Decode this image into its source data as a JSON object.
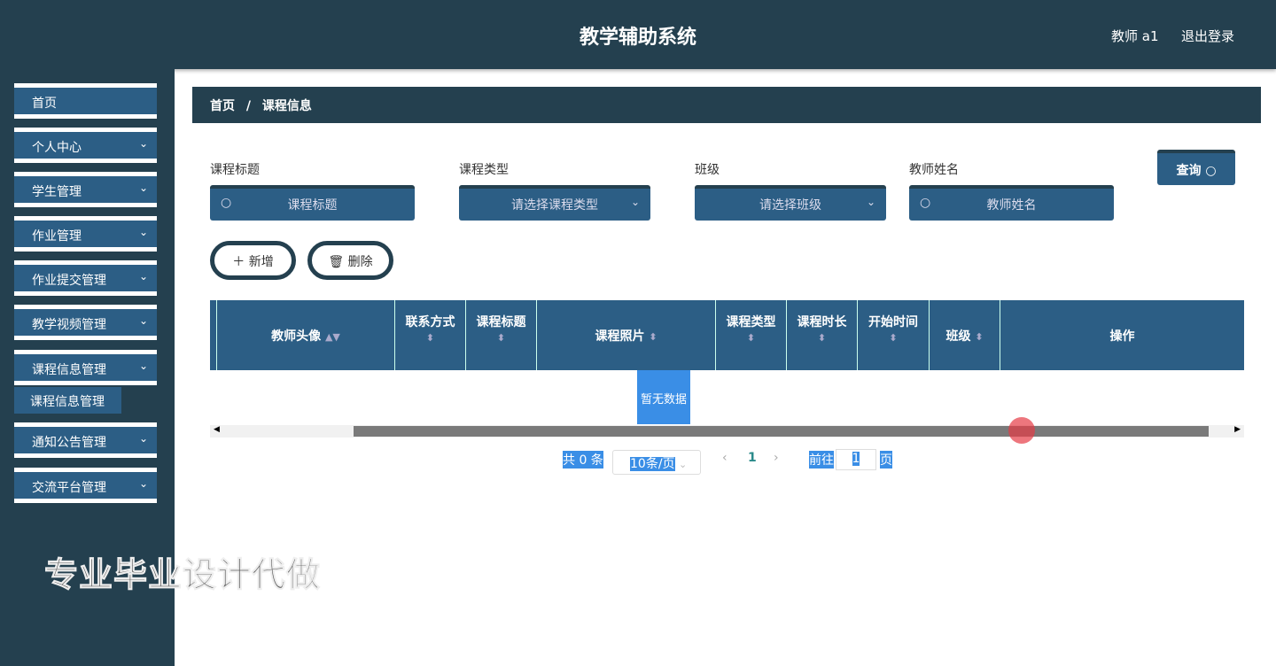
{
  "header": {
    "title": "教学辅助系统",
    "user": "教师 a1",
    "logout": "退出登录"
  },
  "sidebar": {
    "items": [
      {
        "label": "首页"
      },
      {
        "label": "个人中心"
      },
      {
        "label": "学生管理"
      },
      {
        "label": "作业管理"
      },
      {
        "label": "作业提交管理"
      },
      {
        "label": "教学视频管理"
      },
      {
        "label": "课程信息管理"
      },
      {
        "label": "通知公告管理"
      },
      {
        "label": "交流平台管理"
      }
    ],
    "sub_item": "课程信息管理"
  },
  "watermark": "专业毕业设计代做",
  "breadcrumb": {
    "home": "首页",
    "sep": "/",
    "current": "课程信息"
  },
  "search": {
    "fields": [
      {
        "label": "课程标题",
        "placeholder": "课程标题"
      },
      {
        "label": "课程类型",
        "placeholder": "请选择课程类型"
      },
      {
        "label": "班级",
        "placeholder": "请选择班级"
      },
      {
        "label": "教师姓名",
        "placeholder": "教师姓名"
      }
    ],
    "query": "查询"
  },
  "actions": {
    "add": "新增",
    "delete": "删除"
  },
  "table": {
    "columns": [
      "教师头像",
      "联系方式",
      "课程标题",
      "课程照片",
      "课程类型",
      "课程时长",
      "开始时间",
      "班级",
      "操作"
    ],
    "empty": "暂无数据"
  },
  "pagination": {
    "total": "共 0 条",
    "page_size": "10条/页",
    "current": "1",
    "goto": "前往",
    "goto_value": "1",
    "page_suffix": "页"
  }
}
